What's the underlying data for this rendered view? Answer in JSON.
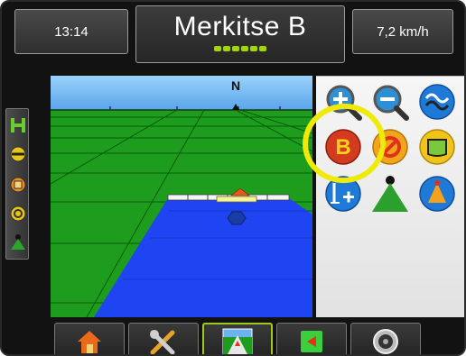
{
  "header": {
    "time": "13:14",
    "title": "Merkitse B",
    "speed": "7,2 km/h",
    "guidance_leds": 6
  },
  "map": {
    "compass": "N"
  },
  "colors": {
    "sky": "#6ab3ee",
    "field": "#1d9c1d",
    "coverage": "#1f44f2",
    "highlight": "#f0ea0a",
    "led": "#a4d600"
  },
  "icon_panel": {
    "buttons": [
      "zoom-in-icon",
      "zoom-out-icon",
      "guidance-lines-icon",
      "mark-b-icon",
      "cancel-icon",
      "boundary-icon",
      "mark-a-plus-icon",
      "vehicle-view-icon",
      "perspective-view-icon"
    ],
    "mark_b_letter": "B",
    "highlighted": "mark-b-icon"
  },
  "left_status": [
    "section-icon",
    "lightbar-icon",
    "boom-icon",
    "guidance-icon",
    "vehicle-icon"
  ],
  "bottom_tabs": [
    "home-icon",
    "settings-icon",
    "guidance-icon",
    "field-icon",
    "gnss-icon"
  ],
  "selected_tab": "guidance"
}
